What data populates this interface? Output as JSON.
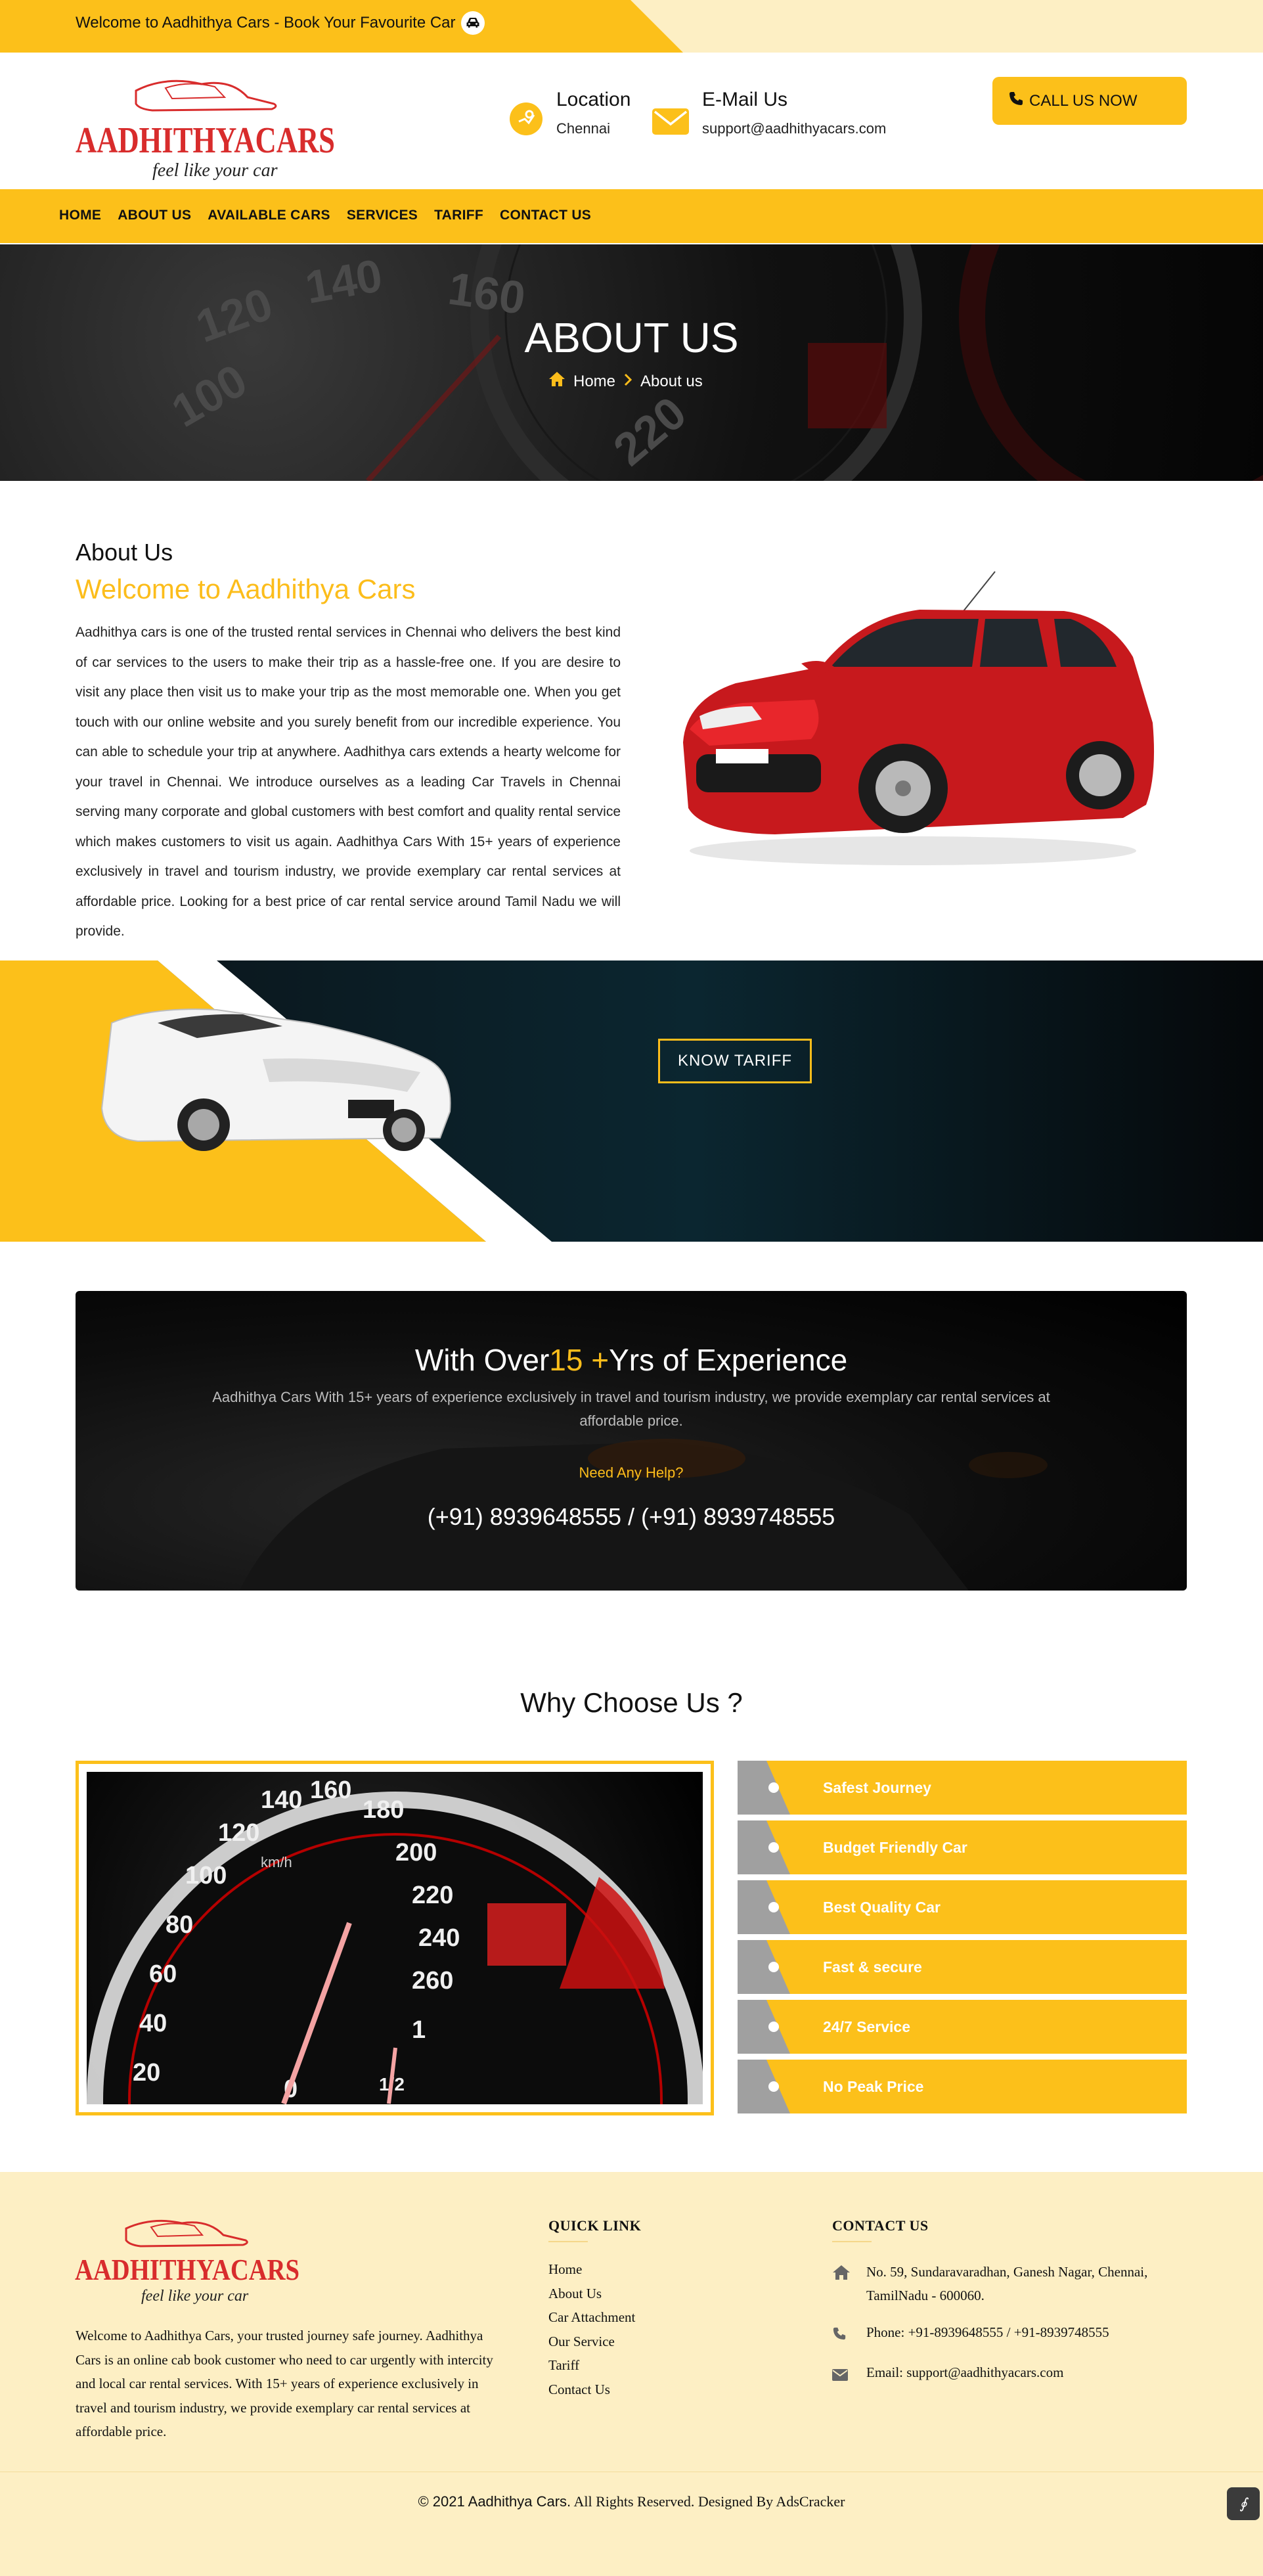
{
  "topbar": {
    "text": "Welcome to Aadhithya Cars - Book Your Favourite Car"
  },
  "logo": {
    "name": "AADHITHYACARS",
    "tagline": "feel like your car"
  },
  "header": {
    "location_title": "Location",
    "location_value": "Chennai",
    "email_title": "E-Mail Us",
    "email_value": "support@aadhithyacars.com",
    "call_label": "CALL US NOW"
  },
  "nav": {
    "items": [
      "HOME",
      "ABOUT US",
      "AVAILABLE CARS",
      "SERVICES",
      "TARIFF",
      "CONTACT US"
    ]
  },
  "hero": {
    "title": "ABOUT US",
    "breadcrumb_home": "Home",
    "breadcrumb_current": "About us",
    "speedo_numbers": [
      "100",
      "120",
      "140",
      "160",
      "220"
    ]
  },
  "about": {
    "label": "About Us",
    "heading": "Welcome to Aadhithya Cars",
    "body": "Aadhithya cars is one of the trusted rental services in Chennai who delivers the best kind of car services to the users to make their trip as a hassle-free one. If you are desire to visit any place then visit us to make your trip as the most memorable one. When you get touch with our online website and you surely benefit from our incredible experience. You can able to schedule your trip at anywhere. Aadhithya cars extends a hearty welcome for your travel in Chennai. We introduce ourselves as a leading Car Travels in Chennai serving many corporate and global customers with best comfort and quality rental service which makes customers to visit us again. Aadhithya Cars With 15+ years of experience exclusively in travel and tourism industry, we provide exemplary car rental services at affordable price. Looking for a best price of car rental service around Tamil Nadu we will provide."
  },
  "banner": {
    "button_label": "KNOW TARIFF"
  },
  "experience": {
    "title_pre": "With Over",
    "title_highlight": "15 +",
    "title_post": "Yrs of Experience",
    "text": "Aadhithya Cars With 15+ years of experience exclusively in travel and tourism industry, we provide exemplary car rental services at affordable price.",
    "help": "Need Any Help?",
    "phone": "(+91) 8939648555 / (+91) 8939748555"
  },
  "why": {
    "title": "Why Choose Us ?",
    "items": [
      "Safest Journey",
      "Budget Friendly Car",
      "Best Quality Car",
      "Fast & secure",
      "24/7 Service",
      "No Peak Price"
    ],
    "gauge_numbers": [
      "20",
      "40",
      "60",
      "80",
      "100",
      "120",
      "140",
      "160",
      "180",
      "200",
      "220",
      "240",
      "260",
      "0",
      "1",
      "1/2"
    ],
    "gauge_unit": "km/h"
  },
  "footer": {
    "about": "Welcome to Aadhithya Cars, your trusted journey safe journey. Aadhithya Cars is an online cab book customer who need to car urgently with intercity and local car rental services. With 15+ years of experience exclusively in travel and tourism industry, we provide exemplary car rental services at affordable price.",
    "quick_link_title": "QUICK LINK",
    "links": [
      "Home",
      "About Us",
      "Car Attachment",
      "Our Service",
      "Tariff",
      "Contact Us"
    ],
    "contact_title": "CONTACT US",
    "address": "No. 59, Sundaravaradhan, Ganesh Nagar, Chennai, TamilNadu - 600060.",
    "phone": "Phone: +91-8939648555 / +91-8939748555",
    "email": "Email: support@aadhithyacars.com",
    "copyright_brand": "© 2021 Aadhithya Cars.",
    "copyright_rest": " All Rights Reserved. Designed By AdsCracker",
    "badge": "∮"
  },
  "colors": {
    "accent": "#fcc01a",
    "light": "#fdefc4",
    "brand_red": "#d82c2c"
  }
}
